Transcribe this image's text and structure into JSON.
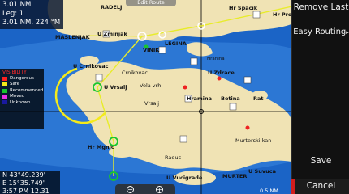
{
  "sidebar": {
    "remove_last": "Remove Last",
    "easy_routing": "Easy Routing",
    "save": "Save",
    "cancel": "Cancel"
  },
  "info": {
    "line1": "3.01 NM",
    "line2": "Leg: 1",
    "line3": "3.01 NM, 224 °M"
  },
  "position": {
    "lat": "N  43°49.239'",
    "lon": "E  15°35.749'",
    "line3": "3:57 PM  12.31"
  },
  "edit_tab": "Edit Route",
  "legend": {
    "title": "VISIBILITY",
    "items": [
      {
        "label": "Dangerous",
        "color": "#ff2020"
      },
      {
        "label": "Safe",
        "color": "#f4ea1a"
      },
      {
        "label": "Recommended",
        "color": "#19c62f"
      },
      {
        "label": "Moved",
        "color": "#ee30e6"
      },
      {
        "label": "Unknown",
        "color": "#1a1aa0"
      }
    ]
  },
  "map_labels": {
    "radelj": "RADELJ",
    "masleniak": "MASLENJAK",
    "u_zminjak": "U Zminjak",
    "u_crnikovac": "U Crnikovac",
    "crnikovac": "Crnikovac",
    "vela_vrh": "Vela vrh",
    "u_vrsalj": "U Vrsalj",
    "vrsalj": "Vrsalj",
    "u_zdrace": "U Zdrace",
    "hramina": "Hramina",
    "betina": "Betina",
    "rat": "Rat",
    "murter": "MURTER",
    "murterskikan": "Murterski kan",
    "raduc": "Raduc",
    "hr_mgnic": "Hr Mgnic",
    "u_vucigrade": "U Vucigrade",
    "u_suvuca": "U Suvuca",
    "legina": "LEGINA",
    "vinik": "VINIK",
    "hr_spacik": "Hr Spacik",
    "hr_prost": "Hr Prost",
    "hranina": "Hranina",
    "scale": "0.5 NM"
  },
  "colors": {
    "deep_water": "#1b64c6",
    "shallow_water": "#3a86e0",
    "land": "#f0e3b4",
    "route": "#e8ec2a",
    "waypoint": "#ffffff",
    "accent_red": "#d21d1d"
  }
}
